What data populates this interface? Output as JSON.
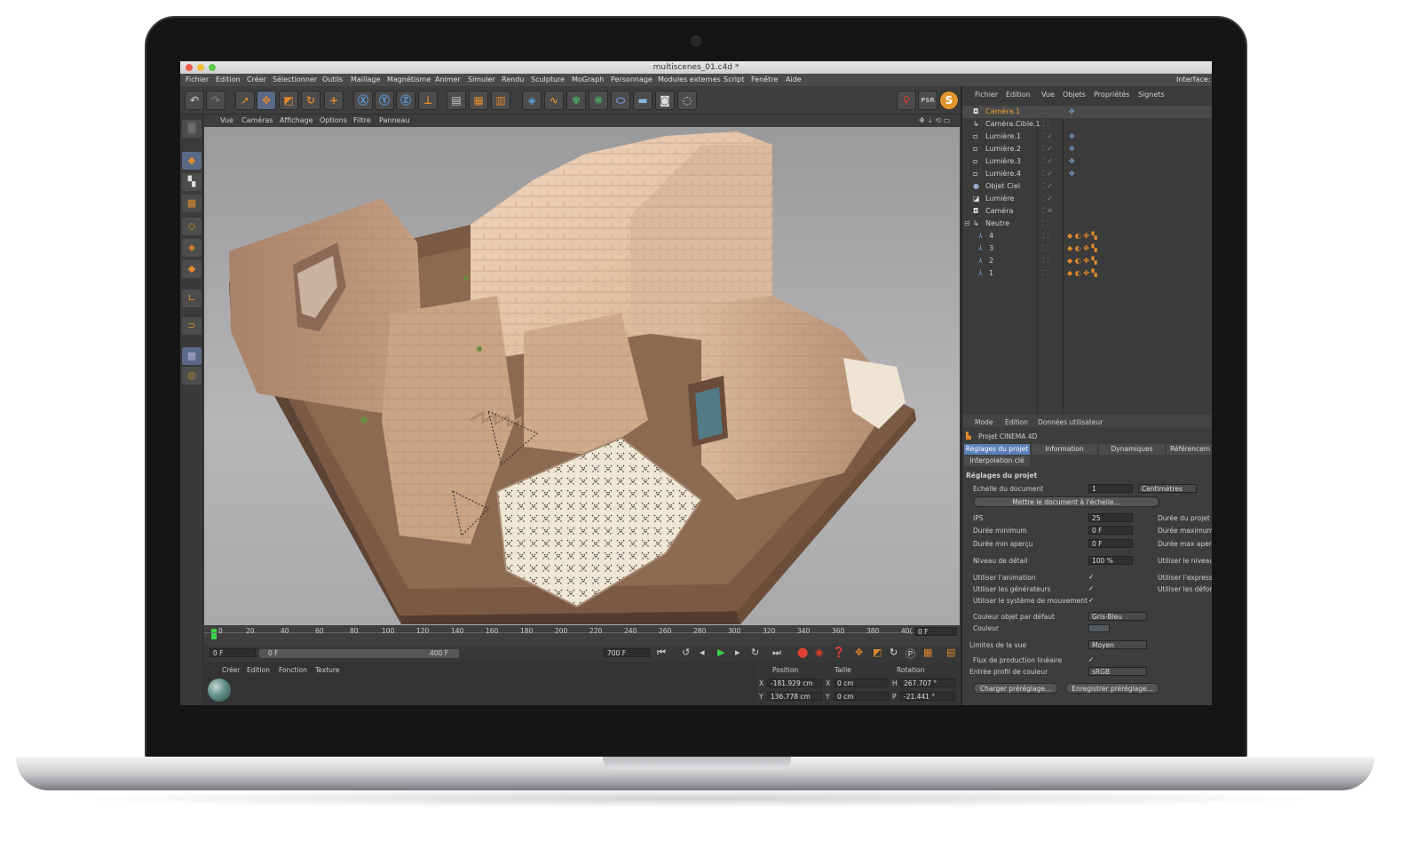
{
  "window": {
    "title": "multiscenes_01.c4d *"
  },
  "menubar": {
    "items": [
      "Fichier",
      "Edition",
      "Créer",
      "Sélectionner",
      "Outils",
      "Maillage",
      "Magnétisme",
      "Animer",
      "Simuler",
      "Rendu",
      "Sculpture",
      "MoGraph",
      "Personnage",
      "Modules externes",
      "Script",
      "Fenêtre",
      "Aide"
    ],
    "interface_label": "Interface:"
  },
  "viewport_menu": {
    "items": [
      "Vue",
      "Caméras",
      "Affichage",
      "Options",
      "Filtre",
      "Panneau"
    ]
  },
  "object_manager": {
    "menu": [
      "Fichier",
      "Edition",
      "Vue",
      "Objets",
      "Propriétés",
      "Signets"
    ],
    "objects": [
      "Caméra.1",
      "Caméra.Cible.1",
      "Lumière.1",
      "Lumière.2",
      "Lumière.3",
      "Lumière.4",
      "Objet Ciel",
      "Lumière",
      "Caméra",
      "Neutre",
      "4",
      "3",
      "2",
      "1"
    ]
  },
  "timeline": {
    "ticks": [
      "0",
      "20",
      "40",
      "60",
      "80",
      "100",
      "120",
      "140",
      "160",
      "180",
      "200",
      "220",
      "240",
      "260",
      "280",
      "300",
      "320",
      "340",
      "360",
      "380",
      "40("
    ],
    "current_frame": "0 F",
    "start_field": "0 F",
    "range_start": "0 F",
    "range_end": "400 F",
    "end_field": "700 F"
  },
  "material_manager": {
    "menu": [
      "Créer",
      "Edition",
      "Fonction",
      "Texture"
    ]
  },
  "coordinates": {
    "headers": [
      "Position",
      "Taille",
      "Rotation"
    ],
    "rows": [
      {
        "axis1": "X",
        "pos": "-181.929 cm",
        "axis2": "X",
        "size": "0 cm",
        "axis3": "H",
        "rot": "267.707 °"
      },
      {
        "axis1": "Y",
        "pos": "136.778 cm",
        "axis2": "Y",
        "size": "0 cm",
        "axis3": "P",
        "rot": "-21.441 °"
      }
    ]
  },
  "attribute_manager": {
    "menu": [
      "Mode",
      "Edition",
      "Données utilisateur"
    ],
    "object_title": "Projet CINEMA 4D",
    "tabs": [
      "Réglages du projet",
      "Information",
      "Dynamiques",
      "Référencem",
      "Interpolation clé"
    ],
    "section_title": "Réglages du projet",
    "doc_scale_label": "Echelle du document",
    "doc_scale_value": "1",
    "doc_scale_unit": "Centimètres",
    "scale_button": "Mettre le document à l'échelle...",
    "ips_label": "IPS",
    "ips_value": "25",
    "min_dur_label": "Durée minimum",
    "min_dur_value": "0 F",
    "min_preview_label": "Durée min aperçu",
    "min_preview_value": "0 F",
    "right_col": [
      "Durée du projet",
      "Durée maximum",
      "Durée max aperç"
    ],
    "lod_label": "Niveau de détail",
    "lod_value": "100 %",
    "lod_right": "Utiliser le niveau",
    "checks": [
      "Utiliser l'animation",
      "Utiliser les générateurs",
      "Utiliser le système de mouvement"
    ],
    "checks_right": [
      "Utiliser l'express",
      "Utiliser les défor"
    ],
    "color_default_label": "Couleur objet par défaut",
    "color_default_value": "Gris-Bleu",
    "color_label": "Couleur",
    "view_limit_label": "Limites de la vue",
    "view_limit_value": "Moyen",
    "linear_label": "Flux de production linéaire",
    "color_profile_label": "Entrée profil de couleur",
    "color_profile_value": "sRGB",
    "load_button": "Charger préréglage...",
    "save_button": "Enregistrer préréglage..."
  },
  "colors": {
    "accent": "#e08a2c",
    "selected_tab": "#5a7fb8",
    "selected_object": "#f0a030"
  }
}
